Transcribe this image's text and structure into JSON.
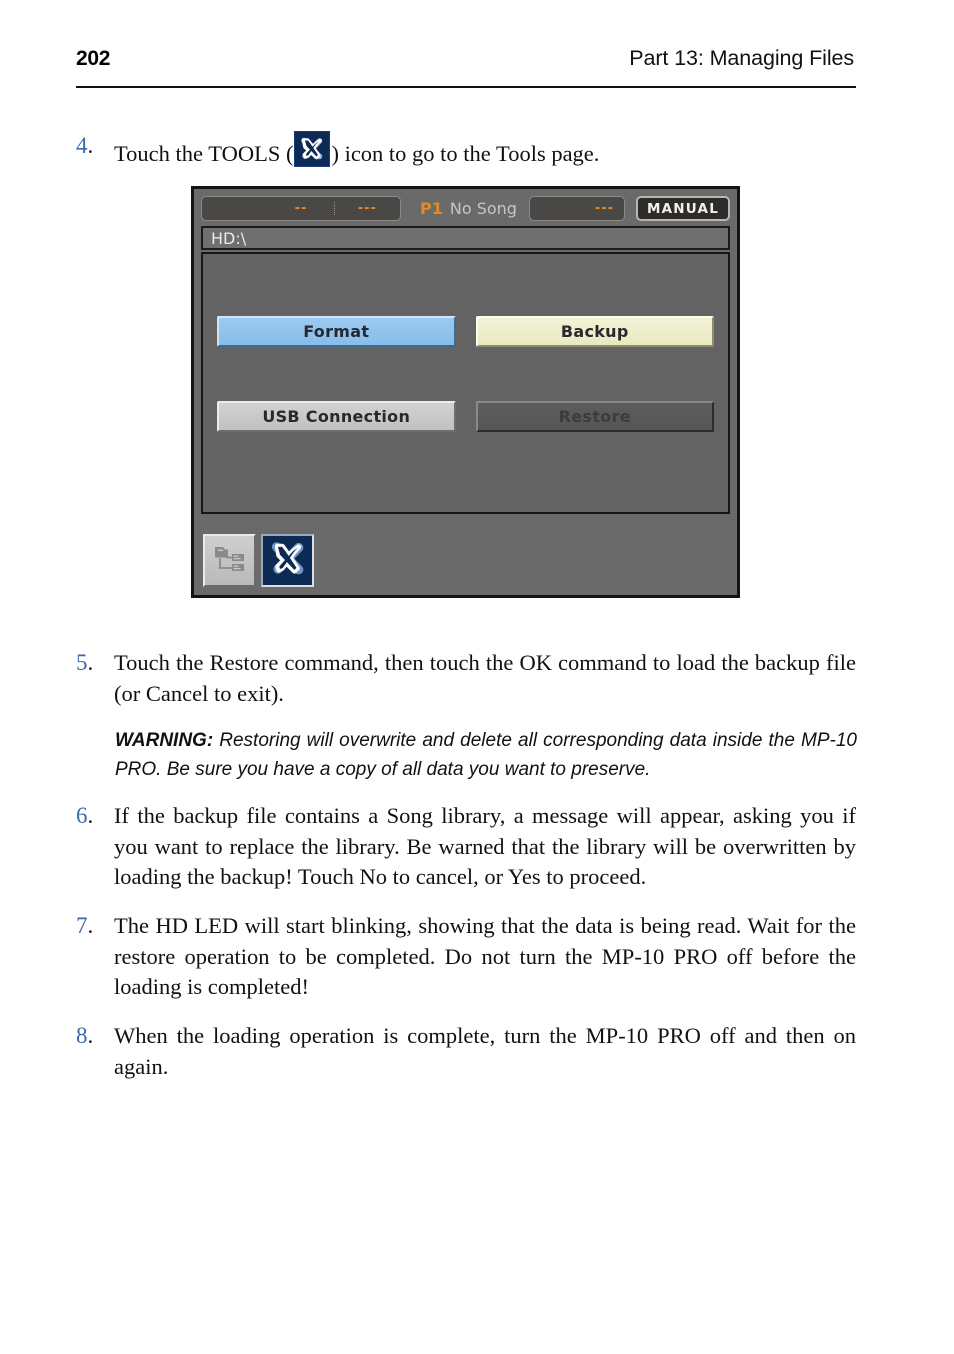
{
  "header": {
    "page_number": "202",
    "part_title": "Part 13: Managing Files"
  },
  "steps": [
    {
      "number": "4.",
      "text_before_icon": "Touch the TOOLS (",
      "icon": "tools-icon",
      "text_after_icon": ") icon to go to the Tools page."
    },
    {
      "number": "5.",
      "text": "Touch the Restore command, then touch the OK command to load the backup file (or Cancel to exit)."
    },
    {
      "number": "6.",
      "text": "If the backup file contains a Song library, a message will appear, asking you if you want to replace the library. Be warned that the library will be overwritten by loading the backup! Touch No to cancel, or Yes to proceed."
    },
    {
      "number": "7.",
      "text": "The HD LED will start blinking, showing that the data is being read. Wait for the restore operation to be completed. Do not turn the MP-10 PRO off before the loading is completed!"
    },
    {
      "number": "8.",
      "text": "When the loading operation is complete, turn the MP-10 PRO off and then on again."
    }
  ],
  "warning": {
    "label": "WARNING:",
    "text": " Restoring will overwrite and delete all corresponding data inside the MP-10 PRO. Be sure you have a copy of all data you want to preserve."
  },
  "device_screenshot": {
    "status_bar": {
      "cell_1": "",
      "cell_2": "--",
      "cell_3": "---",
      "song_number": "P1",
      "song_name": "No Song",
      "right_value": "---",
      "mode_badge": "MANUAL"
    },
    "path_bar": {
      "path": "HD:\\"
    },
    "buttons": [
      {
        "label": "Format",
        "style": "blue",
        "state": "enabled"
      },
      {
        "label": "Backup",
        "style": "cream",
        "state": "enabled"
      },
      {
        "label": "USB Connection",
        "style": "gray",
        "state": "enabled"
      },
      {
        "label": "Restore",
        "style": "disabled",
        "state": "disabled"
      }
    ],
    "tabs": [
      {
        "name": "file-browser-tab",
        "selected": false,
        "icon": "folder-tree-icon"
      },
      {
        "name": "tools-tab",
        "selected": true,
        "icon": "tools-icon"
      }
    ]
  },
  "colors": {
    "step_number": "#3a6aab",
    "accent_orange": "#e08a28",
    "format_button": "#8fc4ed",
    "backup_button": "#efefc8",
    "usb_button": "#c8c8c8",
    "restore_button": "#5a5a5a",
    "tools_tab": "#0d2a55",
    "device_background": "#6a6a6a"
  }
}
